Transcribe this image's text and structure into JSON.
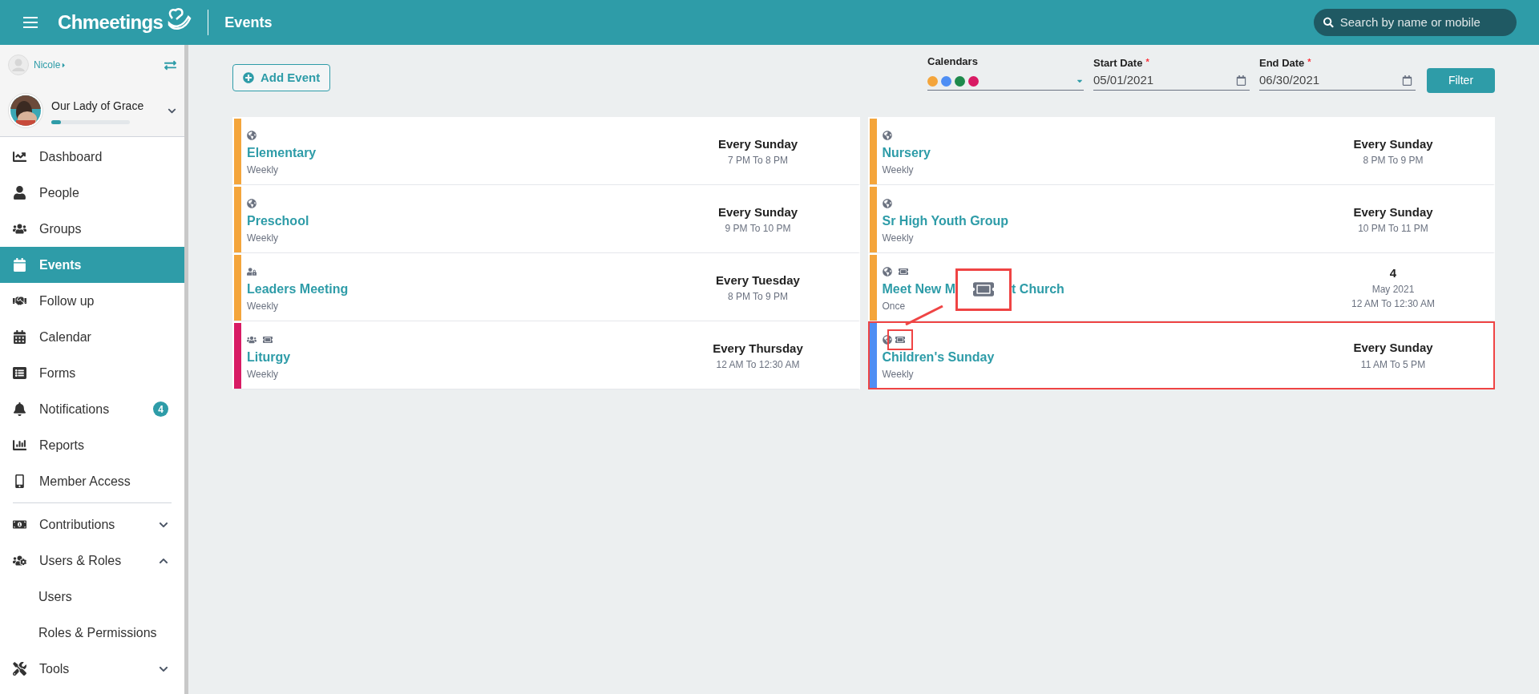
{
  "header": {
    "brand": "Chmeetings",
    "page_title": "Events",
    "search": {
      "placeholder": "Search by name or mobile"
    }
  },
  "sidebar": {
    "user": {
      "name": "Nicole"
    },
    "church": {
      "name": "Our Lady of Grace",
      "level": 0.12
    },
    "items": [
      {
        "label": "Dashboard",
        "selected": false
      },
      {
        "label": "People",
        "selected": false
      },
      {
        "label": "Groups",
        "selected": false
      },
      {
        "label": "Events",
        "selected": true
      },
      {
        "label": "Follow up",
        "selected": false
      },
      {
        "label": "Calendar",
        "selected": false
      },
      {
        "label": "Forms",
        "selected": false
      },
      {
        "label": "Notifications",
        "selected": false,
        "badge": "4"
      },
      {
        "label": "Reports",
        "selected": false
      },
      {
        "label": "Member Access",
        "selected": false
      },
      {
        "label": "Contributions",
        "selected": false,
        "expanded": false
      },
      {
        "label": "Users & Roles",
        "selected": false,
        "expanded": true,
        "children": [
          {
            "label": "Users",
            "selected": false
          },
          {
            "label": "Roles & Permissions",
            "selected": false
          }
        ]
      },
      {
        "label": "Tools",
        "selected": false,
        "expanded": false
      }
    ]
  },
  "toolbar": {
    "add_button": "Add Event",
    "calendars": {
      "label": "Calendars",
      "dots": [
        {
          "color": "#f4a53b"
        },
        {
          "color": "#4e8ef4"
        },
        {
          "color": "#1e8a4c"
        },
        {
          "color": "#d81b64"
        }
      ]
    },
    "start_date": {
      "label": "Start Date",
      "value": "05/01/2021",
      "required_mark": "*"
    },
    "end_date": {
      "label": "End Date",
      "value": "06/30/2021",
      "required_mark": "*"
    },
    "filter_button": "Filter"
  },
  "columns": [
    {
      "events": [
        {
          "icons": [
            {
              "kind": "globe"
            }
          ],
          "title_parts": [
            "Elementary"
          ],
          "recurrence": "Weekly",
          "color": "#f4a53b",
          "highlighted": false,
          "schedule": {
            "kind": "recurring",
            "day": "Every Sunday",
            "time": "7 PM To 8 PM"
          }
        },
        {
          "icons": [
            {
              "kind": "globe"
            }
          ],
          "title_parts": [
            "Preschool"
          ],
          "recurrence": "Weekly",
          "color": "#f4a53b",
          "highlighted": false,
          "schedule": {
            "kind": "recurring",
            "day": "Every Sunday",
            "time": "9 PM To 10 PM"
          }
        },
        {
          "icons": [
            {
              "kind": "user-lock"
            }
          ],
          "title_parts": [
            "Leaders Meeting"
          ],
          "recurrence": "Weekly",
          "color": "#f4a53b",
          "highlighted": false,
          "schedule": {
            "kind": "recurring",
            "day": "Every Tuesday",
            "time": "8 PM To 9 PM"
          }
        },
        {
          "icons": [
            {
              "kind": "users"
            },
            {
              "kind": "ticket"
            }
          ],
          "title_parts": [
            "Liturgy"
          ],
          "recurrence": "Weekly",
          "color": "#d81b64",
          "highlighted": false,
          "schedule": {
            "kind": "recurring",
            "day": "Every Thursday",
            "time": "12 AM To 12:30 AM"
          }
        }
      ]
    },
    {
      "events": [
        {
          "icons": [
            {
              "kind": "globe"
            }
          ],
          "title_parts": [
            "Nursery"
          ],
          "recurrence": "Weekly",
          "color": "#f4a53b",
          "highlighted": false,
          "schedule": {
            "kind": "recurring",
            "day": "Every Sunday",
            "time": "8 PM To 9 PM"
          }
        },
        {
          "icons": [
            {
              "kind": "globe"
            }
          ],
          "title_parts": [
            "Sr High Youth Group"
          ],
          "recurrence": "Weekly",
          "color": "#f4a53b",
          "highlighted": false,
          "schedule": {
            "kind": "recurring",
            "day": "Every Sunday",
            "time": "10 PM To 11 PM"
          }
        },
        {
          "icons": [
            {
              "kind": "globe"
            },
            {
              "kind": "ticket"
            }
          ],
          "title_parts": [
            "Meet New M",
            "t Church"
          ],
          "recurrence": "Once",
          "color": "#f4a53b",
          "highlighted": false,
          "schedule": {
            "kind": "once",
            "day": "4",
            "month": "May 2021",
            "time": "12 AM To 12:30 AM"
          }
        },
        {
          "icons": [
            {
              "kind": "globe"
            },
            {
              "kind": "ticket"
            }
          ],
          "title_parts": [
            "Children's Sunday"
          ],
          "recurrence": "Weekly",
          "color": "#4e8ef4",
          "highlighted": true,
          "schedule": {
            "kind": "recurring",
            "day": "Every Sunday",
            "time": "11 AM To 5 PM"
          }
        }
      ]
    }
  ]
}
